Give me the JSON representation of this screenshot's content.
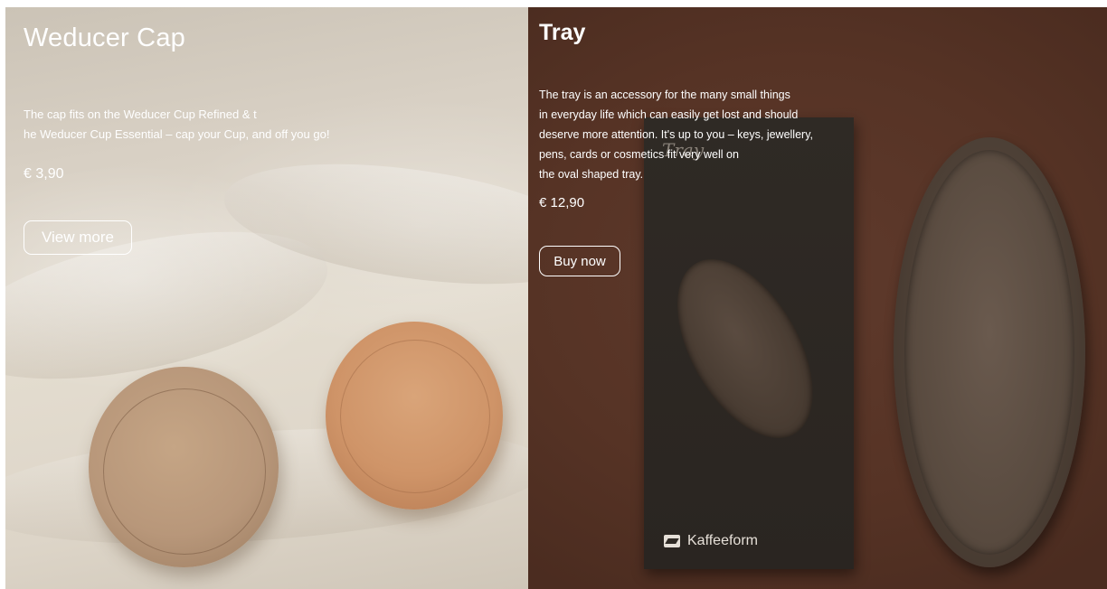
{
  "left_product": {
    "title": "Weducer Cap",
    "description_line1": "The cap fits on the Weducer Cup Refined & t",
    "description_line2": "he Weducer Cup Essential – cap your Cup, and off you go!",
    "price": "€ 3,90",
    "button_label": "View more"
  },
  "right_product": {
    "title": "Tray",
    "description_lines": [
      "The tray is an accessory for the many small things",
      "in everyday life which can easily get lost and should",
      "deserve more attention. It's up to you – keys, jewellery,",
      "pens, cards or cosmetics fit very well on",
      "the oval shaped tray."
    ],
    "price": "€ 12,90",
    "button_label": "Buy now",
    "packaging_brand": "Kaffeeform",
    "packaging_script": "Tray"
  },
  "colors": {
    "left_background": "#d8d0c4",
    "right_background": "#563325",
    "text": "#ffffff"
  }
}
